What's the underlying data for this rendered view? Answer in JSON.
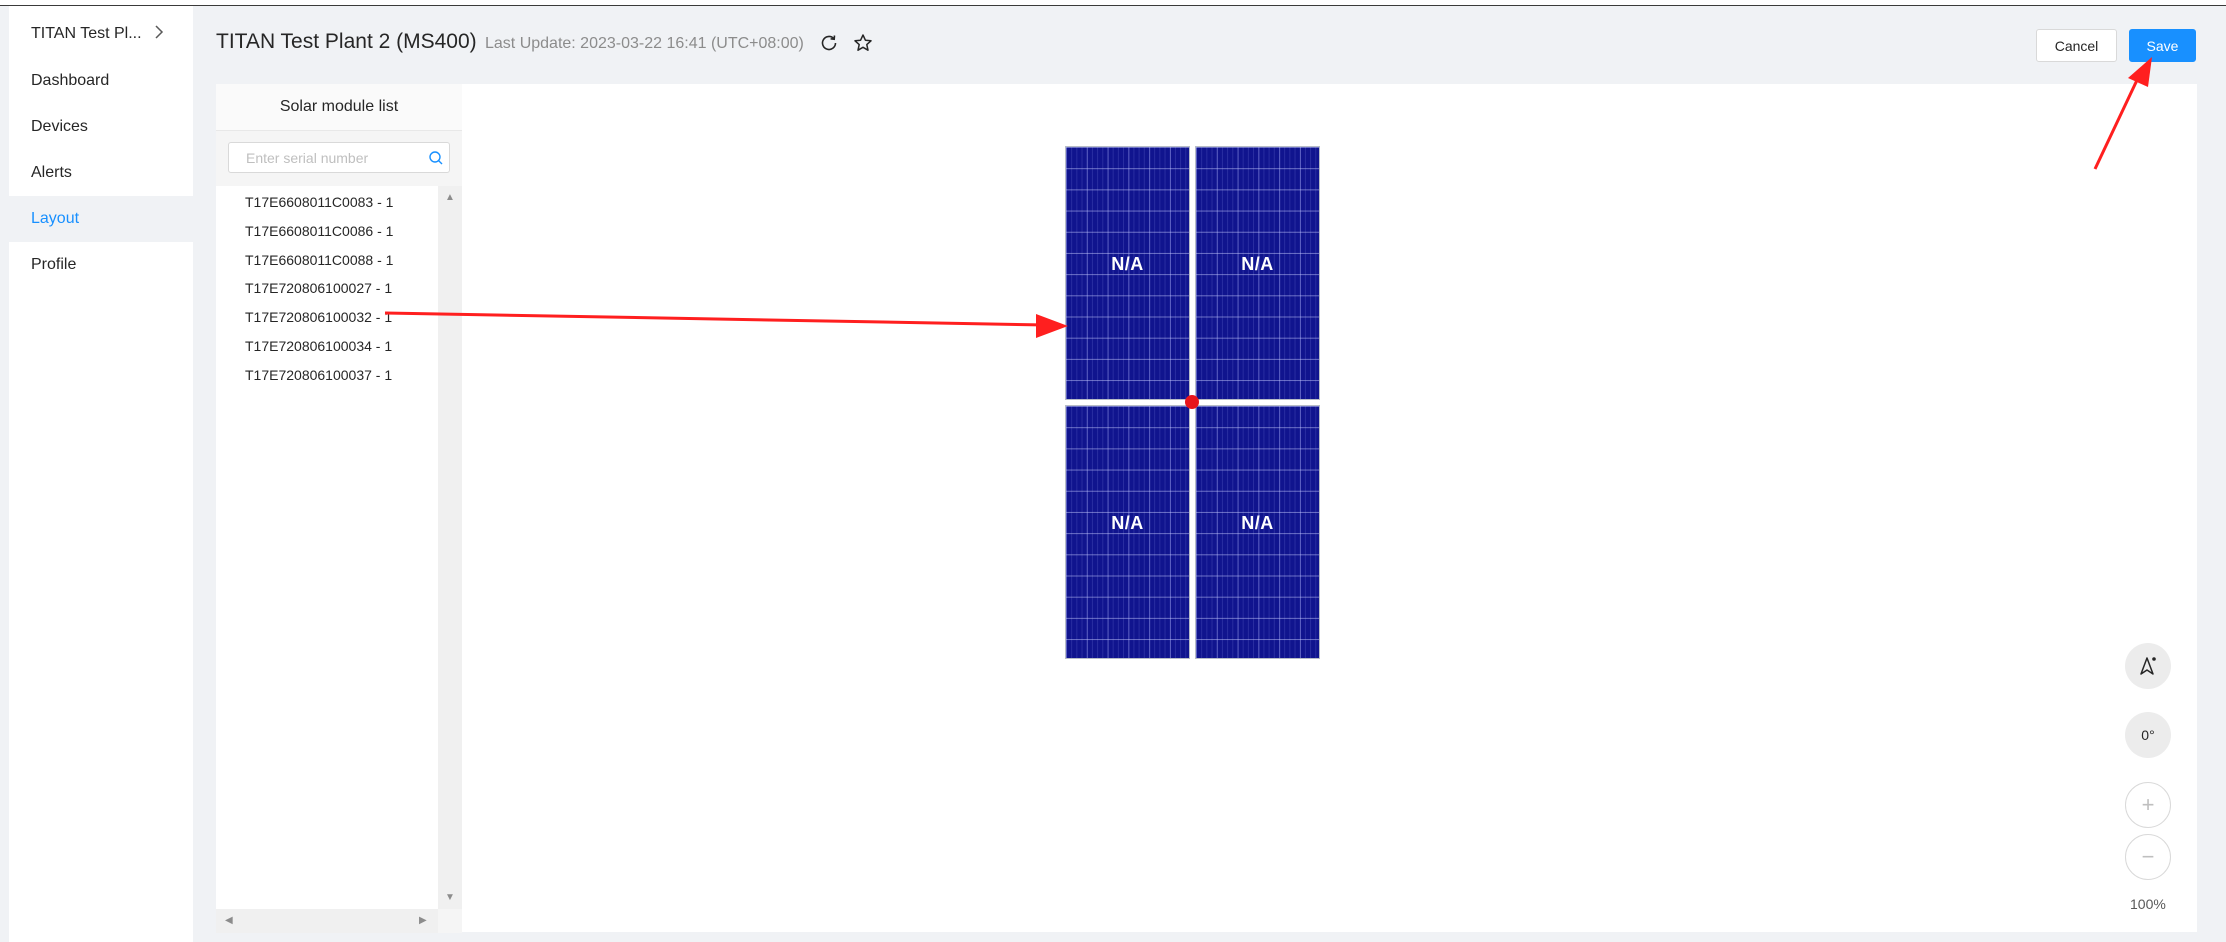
{
  "app": {
    "plant_switch": "TITAN Test Pl...",
    "page_title": "TITAN Test Plant 2 (MS400)",
    "last_update": "Last Update: 2023-03-22 16:41 (UTC+08:00)"
  },
  "sidebar": {
    "items": [
      {
        "label": "Dashboard",
        "active": false
      },
      {
        "label": "Devices",
        "active": false
      },
      {
        "label": "Alerts",
        "active": false
      },
      {
        "label": "Layout",
        "active": true
      },
      {
        "label": "Profile",
        "active": false
      }
    ]
  },
  "toolbar": {
    "cancel_label": "Cancel",
    "save_label": "Save"
  },
  "module_list": {
    "title": "Solar module list",
    "search_placeholder": "Enter serial number",
    "items": [
      "T17E6608011C0083 - 1",
      "T17E6608011C0086 - 1",
      "T17E6608011C0088 - 1",
      "T17E720806100027 - 1",
      "T17E720806100032 - 1",
      "T17E720806100034 - 1",
      "T17E720806100037 - 1"
    ]
  },
  "canvas": {
    "modules": [
      {
        "label": "N/A"
      },
      {
        "label": "N/A"
      },
      {
        "label": "N/A"
      },
      {
        "label": "N/A"
      }
    ]
  },
  "controls": {
    "rotation": "0°",
    "zoom_in": "+",
    "zoom_out": "−",
    "zoom_level": "100%"
  },
  "colors": {
    "accent": "#1890ff",
    "module_fill": "#10148e",
    "annotation": "#e8151b"
  }
}
